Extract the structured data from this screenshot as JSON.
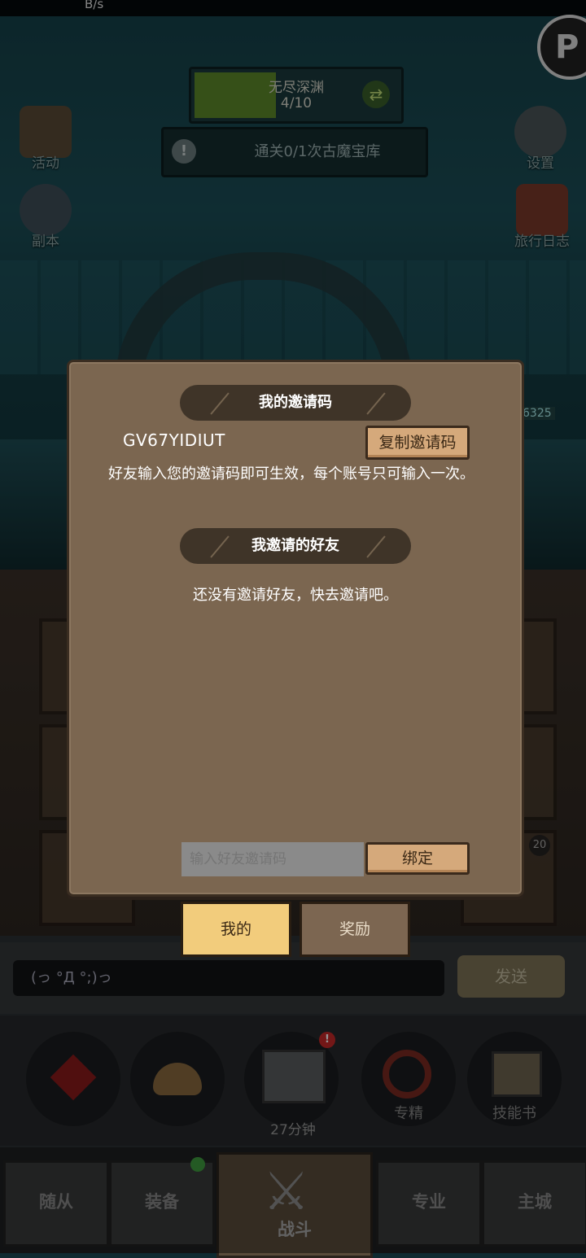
{
  "status_bar": {
    "left": "B/s",
    "right": ""
  },
  "game": {
    "quest": {
      "title": "无尽深渊",
      "progress": "4/10",
      "fill_fraction": 0.4
    },
    "task": {
      "text": "通关0/1次古魔宝库"
    },
    "left_buttons": [
      {
        "label": "活动",
        "icon": "activity-board-icon"
      },
      {
        "label": "副本",
        "icon": "dungeon-portal-icon"
      }
    ],
    "right_buttons": [
      {
        "label": "设置",
        "icon": "gear-icon"
      },
      {
        "label": "旅行日志",
        "icon": "journal-book-icon"
      }
    ],
    "corner_badge": "P",
    "score_tag": "6325",
    "slot_badge": "20"
  },
  "chat": {
    "placeholder": "(っ °Д °;)っ",
    "send_label": "发送"
  },
  "quick_actions": [
    {
      "label": "",
      "icon": "potion-icon"
    },
    {
      "label": "",
      "icon": "bread-icon"
    },
    {
      "label": "27分钟",
      "icon": "treasure-chest-icon",
      "badge": "!"
    },
    {
      "label": "专精",
      "icon": "specialty-icon"
    },
    {
      "label": "技能书",
      "icon": "skill-book-icon"
    }
  ],
  "bottom_nav": {
    "followers": "随从",
    "equipment": "装备",
    "battle": "战斗",
    "profession": "专业",
    "main_city": "主城"
  },
  "modal": {
    "my_code_header": "我的邀请码",
    "invite_code": "GV67YIDIUT",
    "copy_button": "复制邀请码",
    "description": "好友输入您的邀请码即可生效，每个账号只可输入一次。",
    "invited_header": "我邀请的好友",
    "empty_note": "还没有邀请好友，快去邀请吧。",
    "friend_code_placeholder": "输入好友邀请码",
    "bind_button": "绑定"
  },
  "tabs": {
    "mine": "我的",
    "reward": "奖励"
  },
  "colors": {
    "modal_bg": "#7b6650",
    "header_pill": "#3f3428",
    "wood_button": "#d5a97b",
    "active_tab": "#f2cc7c"
  }
}
